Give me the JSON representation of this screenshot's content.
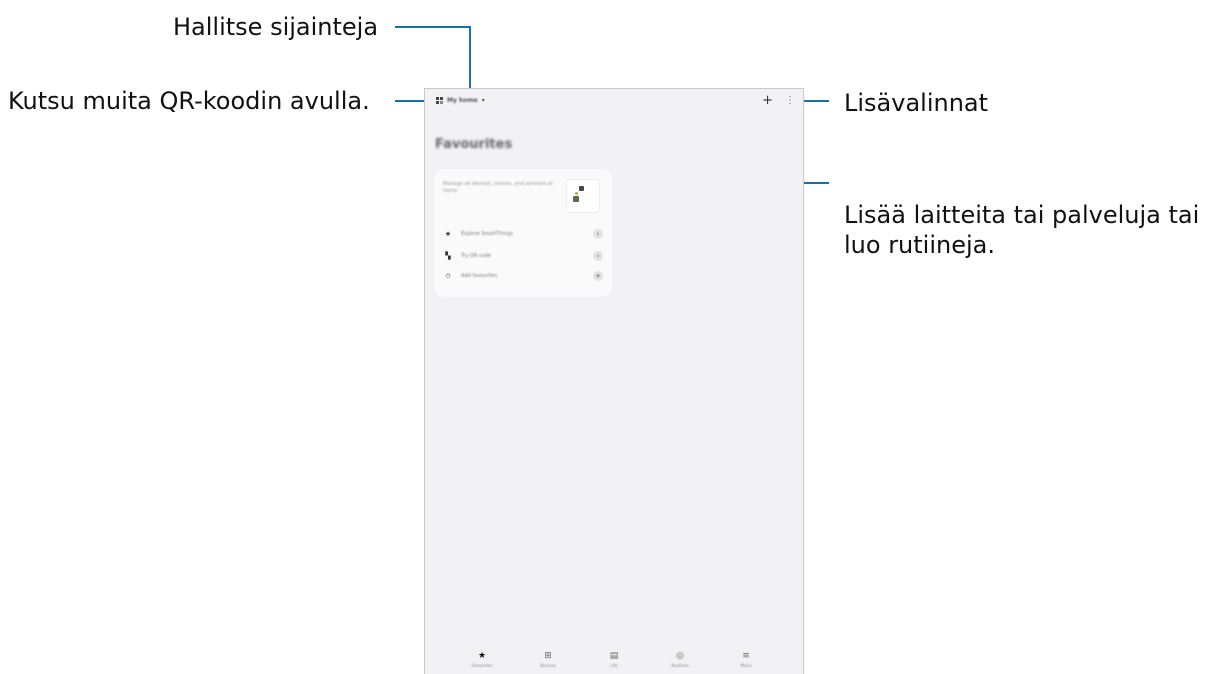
{
  "annotations": {
    "manage_locations": "Hallitse sijainteja",
    "invite_qr": "Kutsu muita QR-koodin avulla.",
    "more_options": "Lisävalinnat",
    "add_devices_line1": "Lisää laitteita tai palveluja tai",
    "add_devices_line2": "luo rutiineja."
  },
  "app": {
    "home_name": "My home",
    "page_title": "Favourites",
    "card": {
      "description": "Manage all devices, scenes, and services at home.",
      "rows": [
        {
          "icon": "star-icon",
          "label": "Explore SmartThings",
          "action": "chevron-right-icon"
        },
        {
          "icon": "qr-code-icon",
          "label": "Try QR code",
          "action": "chevron-right-icon"
        },
        {
          "icon": "star-outline-icon",
          "label": "Add favourites",
          "action": "plus-icon"
        }
      ]
    },
    "nav": [
      {
        "icon": "star-icon",
        "label": "Favourites",
        "active": true
      },
      {
        "icon": "devices-icon",
        "label": "Devices",
        "active": false
      },
      {
        "icon": "life-icon",
        "label": "Life",
        "active": false
      },
      {
        "icon": "routines-icon",
        "label": "Routines",
        "active": false
      },
      {
        "icon": "menu-icon",
        "label": "Menu",
        "active": false
      }
    ]
  },
  "colors": {
    "leader_line": "#1a6fae",
    "screen_bg": "#f2f2f4"
  }
}
